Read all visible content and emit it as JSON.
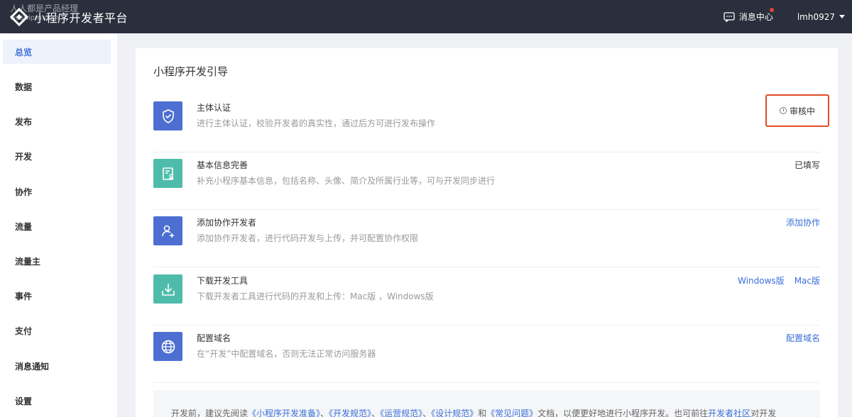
{
  "header": {
    "title": "小程序开发者平台",
    "watermark_line1": "人人都是产品经理",
    "watermark_line2": "woshipm.com",
    "message_center": "消息中心",
    "username": "lmh0927"
  },
  "sidebar": {
    "items": [
      {
        "label": "总览",
        "active": true
      },
      {
        "label": "数据"
      },
      {
        "label": "发布"
      },
      {
        "label": "开发"
      },
      {
        "label": "协作"
      },
      {
        "label": "流量"
      },
      {
        "label": "流量主"
      },
      {
        "label": "事件"
      },
      {
        "label": "支付"
      },
      {
        "label": "消息通知"
      },
      {
        "label": "设置"
      }
    ]
  },
  "main": {
    "title": "小程序开发引导",
    "rows": [
      {
        "title": "主体认证",
        "desc": "进行主体认证，校验开发者的真实性，通过后方可进行发布操作",
        "status": "审核中",
        "icon": "shield-check-icon",
        "icon_color": "#4d6fd1"
      },
      {
        "title": "基本信息完善",
        "desc": "补充小程序基本信息，包括名称、头像、简介及所属行业等，可与开发同步进行",
        "status": "已填写",
        "icon": "profile-card-icon",
        "icon_color": "#4fbcab"
      },
      {
        "title": "添加协作开发者",
        "desc": "添加协作开发者，进行代码开发与上传，并可配置协作权限",
        "action": "添加协作",
        "icon": "add-user-icon",
        "icon_color": "#4d6fd1"
      },
      {
        "title": "下载开发工具",
        "desc": "下载开发者工具进行代码的开发和上传：Mac版 ，Windows版",
        "actions": [
          "Windows版",
          "Mac版"
        ],
        "icon": "download-icon",
        "icon_color": "#4fbcab"
      },
      {
        "title": "配置域名",
        "desc": "在“开发”中配置域名，否则无法正常访问服务器",
        "action": "配置域名",
        "icon": "globe-icon",
        "icon_color": "#4d6fd1"
      }
    ],
    "notice": {
      "prefix": "开发前，建议先阅读",
      "link1": "《小程序开发准备》",
      "sep1": "、",
      "link2": "《开发规范》",
      "sep2": "、",
      "link3": "《运营规范》",
      "sep3": "、",
      "link4": "《设计规范》",
      "and": "和",
      "link5": "《常见问题》",
      "middle": "文档，以便更好地进行小程序开发。也可前往",
      "link6": "开发者社区",
      "suffix": "对开发"
    }
  },
  "colors": {
    "topbar": "#2a2f3d",
    "accent": "#3a6fd8",
    "highlight_border": "#e24c2b"
  }
}
